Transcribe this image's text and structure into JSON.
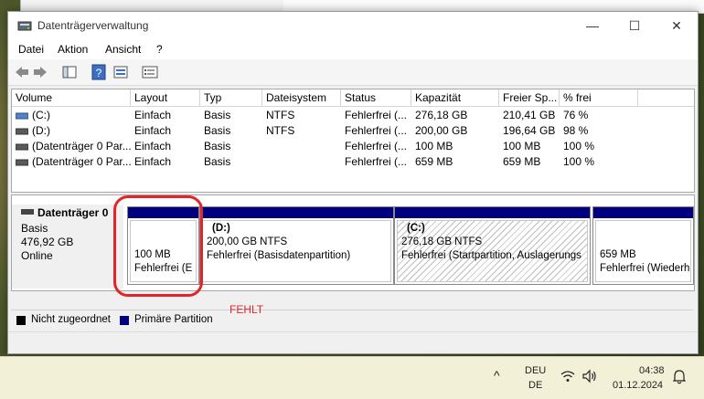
{
  "window": {
    "title": "Datenträgerverwaltung",
    "minimize": "—",
    "maximize": "☐",
    "close": "✕"
  },
  "menu": [
    "Datei",
    "Aktion",
    "Ansicht",
    "?"
  ],
  "columns": [
    "Volume",
    "Layout",
    "Typ",
    "Dateisystem",
    "Status",
    "Kapazität",
    "Freier Sp...",
    "% frei"
  ],
  "volumes": [
    {
      "volume": "(C:)",
      "layout": "Einfach",
      "typ": "Basis",
      "fs": "NTFS",
      "status": "Fehlerfrei (...",
      "cap": "276,18 GB",
      "free": "210,41 GB",
      "pct": "76 %"
    },
    {
      "volume": "(D:)",
      "layout": "Einfach",
      "typ": "Basis",
      "fs": "NTFS",
      "status": "Fehlerfrei (...",
      "cap": "200,00 GB",
      "free": "196,64 GB",
      "pct": "98 %"
    },
    {
      "volume": "(Datenträger 0 Par...",
      "layout": "Einfach",
      "typ": "Basis",
      "fs": "",
      "status": "Fehlerfrei (...",
      "cap": "100 MB",
      "free": "100 MB",
      "pct": "100 %"
    },
    {
      "volume": "(Datenträger 0 Par...",
      "layout": "Einfach",
      "typ": "Basis",
      "fs": "",
      "status": "Fehlerfrei (...",
      "cap": "659 MB",
      "free": "659 MB",
      "pct": "100 %"
    }
  ],
  "disk": {
    "name": "Datenträger 0",
    "type": "Basis",
    "size": "476,92 GB",
    "state": "Online"
  },
  "partitions": [
    {
      "title": "",
      "size": "100 MB",
      "status": "Fehlerfrei (E"
    },
    {
      "title": "(D:)",
      "size": "200,00 GB NTFS",
      "status": "Fehlerfrei (Basisdatenpartition)"
    },
    {
      "title": "(C:)",
      "size": "276,18 GB NTFS",
      "status": "Fehlerfrei (Startpartition, Auslagerungs"
    },
    {
      "title": "",
      "size": "659 MB",
      "status": "Fehlerfrei (Wiederh"
    }
  ],
  "legend": {
    "unallocated": "Nicht zugeordnet",
    "primary": "Primäre Partition"
  },
  "annotation": "FEHLT",
  "colors": {
    "primary": "#00007f",
    "unallocated": "#000000",
    "annotation": "#e3242b"
  },
  "taskbar": {
    "lang1": "DEU",
    "lang2": "DE",
    "time": "04:38",
    "date": "01.12.2024",
    "chevron": "^"
  }
}
